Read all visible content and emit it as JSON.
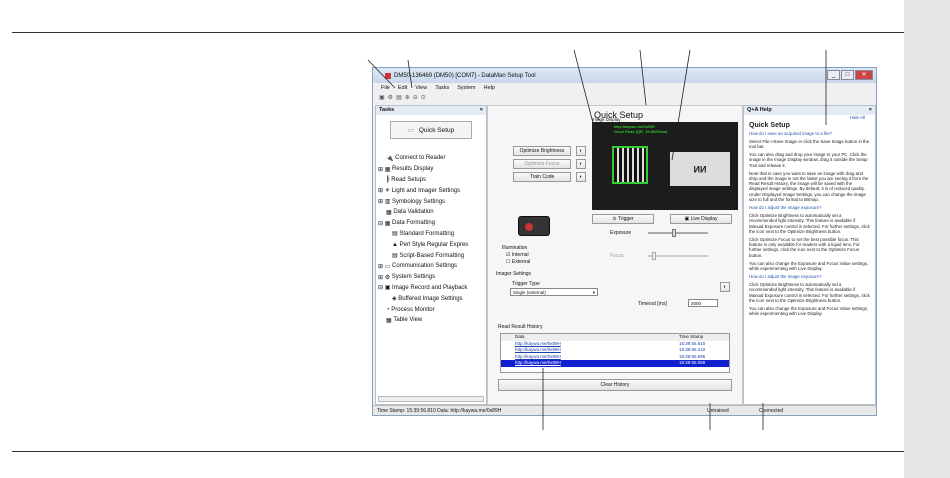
{
  "window": {
    "title": "DM50-136469 (DM50) [COM7] - DataMan Setup Tool"
  },
  "menu": [
    "File",
    "Edit",
    "View",
    "Tasks",
    "System",
    "Help"
  ],
  "tasks": {
    "title": "Tasks",
    "quick_setup": "Quick Setup",
    "items": [
      "Connect to Reader",
      "Results Display",
      "Read Setups",
      "Light and Imager Settings",
      "Symbology Settings",
      "Data Validation",
      "Data Formatting",
      "Standard Formatting",
      "Perl Style Regular Expres",
      "Script-Based Formatting",
      "Communication Settings",
      "System Settings",
      "Image Record and Playback",
      "Buffered Image Settings",
      "Process Monitor",
      "Table View"
    ]
  },
  "main": {
    "title": "Quick Setup",
    "image_display_label": "Image Display",
    "overlay_line1": "http://kaywa.me/0x89H",
    "overlay_line2": "Good Read (QR, 15.89/65ms)",
    "buttons": {
      "optimize_brightness": "Optimize Brightness",
      "optimize_focus": "Optimize Focus",
      "train_code": "Train Code",
      "trigger": "Trigger",
      "live_display": "Live Display",
      "clear_history": "Clear History"
    },
    "exposure_label": "Exposure",
    "focus_label": "Focus",
    "illumination": {
      "label": "Illumination",
      "internal": "Internal",
      "external": "External"
    },
    "imager_settings": "Imager Settings",
    "trigger_type_label": "Trigger Type",
    "trigger_type_value": "Single (external)",
    "timeout_label": "Timeout [ms]",
    "timeout_value": "2000",
    "history": {
      "title": "Read Result History",
      "col_data": "Data",
      "col_time": "Time Stamp",
      "rows": [
        {
          "data": "http://kaywa.me/0x89H",
          "time": "15:39:56.810"
        },
        {
          "data": "http://kaywa.me/0x89H",
          "time": "15:39:56.222"
        },
        {
          "data": "http://kaywa.me/0x89H",
          "time": "15:39:55.695"
        },
        {
          "data": "http://kaywa.me/0x89H",
          "time": "15:39:55.088"
        }
      ]
    }
  },
  "help": {
    "title": "Q+A Help",
    "hide_all": "Hide All",
    "heading": "Quick Setup",
    "q1": "How do I save an acquired image to a file?",
    "p1": "Select File->Save Image or click the Save Image button in the tool bar.",
    "p2": "You can also drag and drop your image to your PC. Click the image in the Image Display window, drag it outside the Setup Tool and release it.",
    "p3": "Note that in case you want to save an image with drag and drop and the image is not the latest you are seeing it from the Read Result History, the image will be saved with the displayed image settings. By default, it is of reduced quality. Under Displayed Image Settings, you can change the image size to full and the format to Bitmap.",
    "q2": "How do I adjust the image exposure?",
    "p4": "Click Optimize Brightness to automatically set a recommended light intensity. This feature is available if Manual Exposure control is selected. For further settings, click the icon next to the Optimize Brightness button.",
    "p5": "Click Optimize Focus to set the best possible focus. This feature is only available for readers with a liquid lens. For further settings, click the icon next to the Optimize Focus button.",
    "p6": "You can also change the Exposure and Focus Value settings, while experimenting with Live Display.",
    "q3": "How do I adjust the image exposure?",
    "p7": "Click Optimize Brightness to automatically set a recommended light intensity. This feature is available if Manual Exposure control is selected. For further settings, click the icon next to the Optimize Brightness button.",
    "p8": "You can also change the Exposure and Focus Value settings, while experimenting with Live Display."
  },
  "status": {
    "left": "Time Stamp: 15:39:56.810  Data: http://kaywa.me/0x89H",
    "trained": "Untrained",
    "connection": "Connected"
  }
}
